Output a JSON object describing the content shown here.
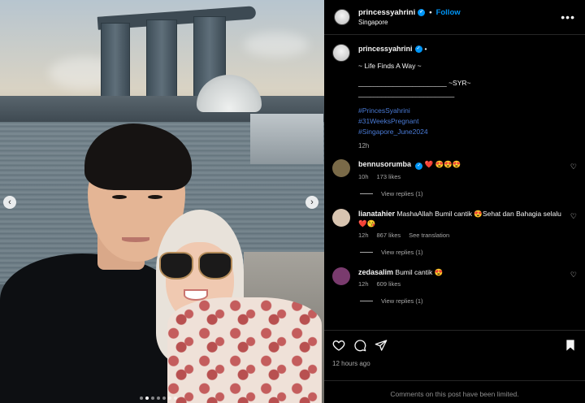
{
  "post": {
    "username": "princessyahrini",
    "follow_label": "Follow",
    "location": "Singapore",
    "separator": "•"
  },
  "caption": {
    "username": "princessyahrini",
    "dot": "•",
    "line1": "~ Life Finds A Way ~",
    "line2": "_______________________ ~SYR~",
    "line3": "_________________________",
    "hashtags": [
      "#PrincesSyahrini",
      "#31WeeksPregnant",
      "#Singapore_June2024"
    ],
    "time": "12h"
  },
  "comments": [
    {
      "username": "bennusorumba",
      "verified": true,
      "text": "❤️ 😍😍😍",
      "time": "10h",
      "likes": "173 likes",
      "replies": "View replies (1)",
      "avatar_color": "#7a6a48"
    },
    {
      "username": "lianatahier",
      "verified": false,
      "text": "MashaAllah Bumil cantik 😍Sehat dan Bahagia selalu ❤️😘",
      "time": "12h",
      "likes": "867 likes",
      "translate": "See translation",
      "replies": "View replies (1)",
      "avatar_color": "#d8c4b0"
    },
    {
      "username": "zedasalim",
      "verified": false,
      "text": "Bumil cantik 😍",
      "time": "12h",
      "likes": "609 likes",
      "replies": "View replies (1)",
      "avatar_color": "#7a3b6e"
    }
  ],
  "actions": {
    "posted_time": "12 hours ago",
    "limited_text": "Comments on this post have been limited."
  },
  "carousel": {
    "prev_glyph": "‹",
    "next_glyph": "›",
    "slide_count": 7,
    "active_index": 1
  },
  "colors": {
    "accent": "#0095f6",
    "hashtag": "#4a7bd6",
    "background": "#000000"
  }
}
